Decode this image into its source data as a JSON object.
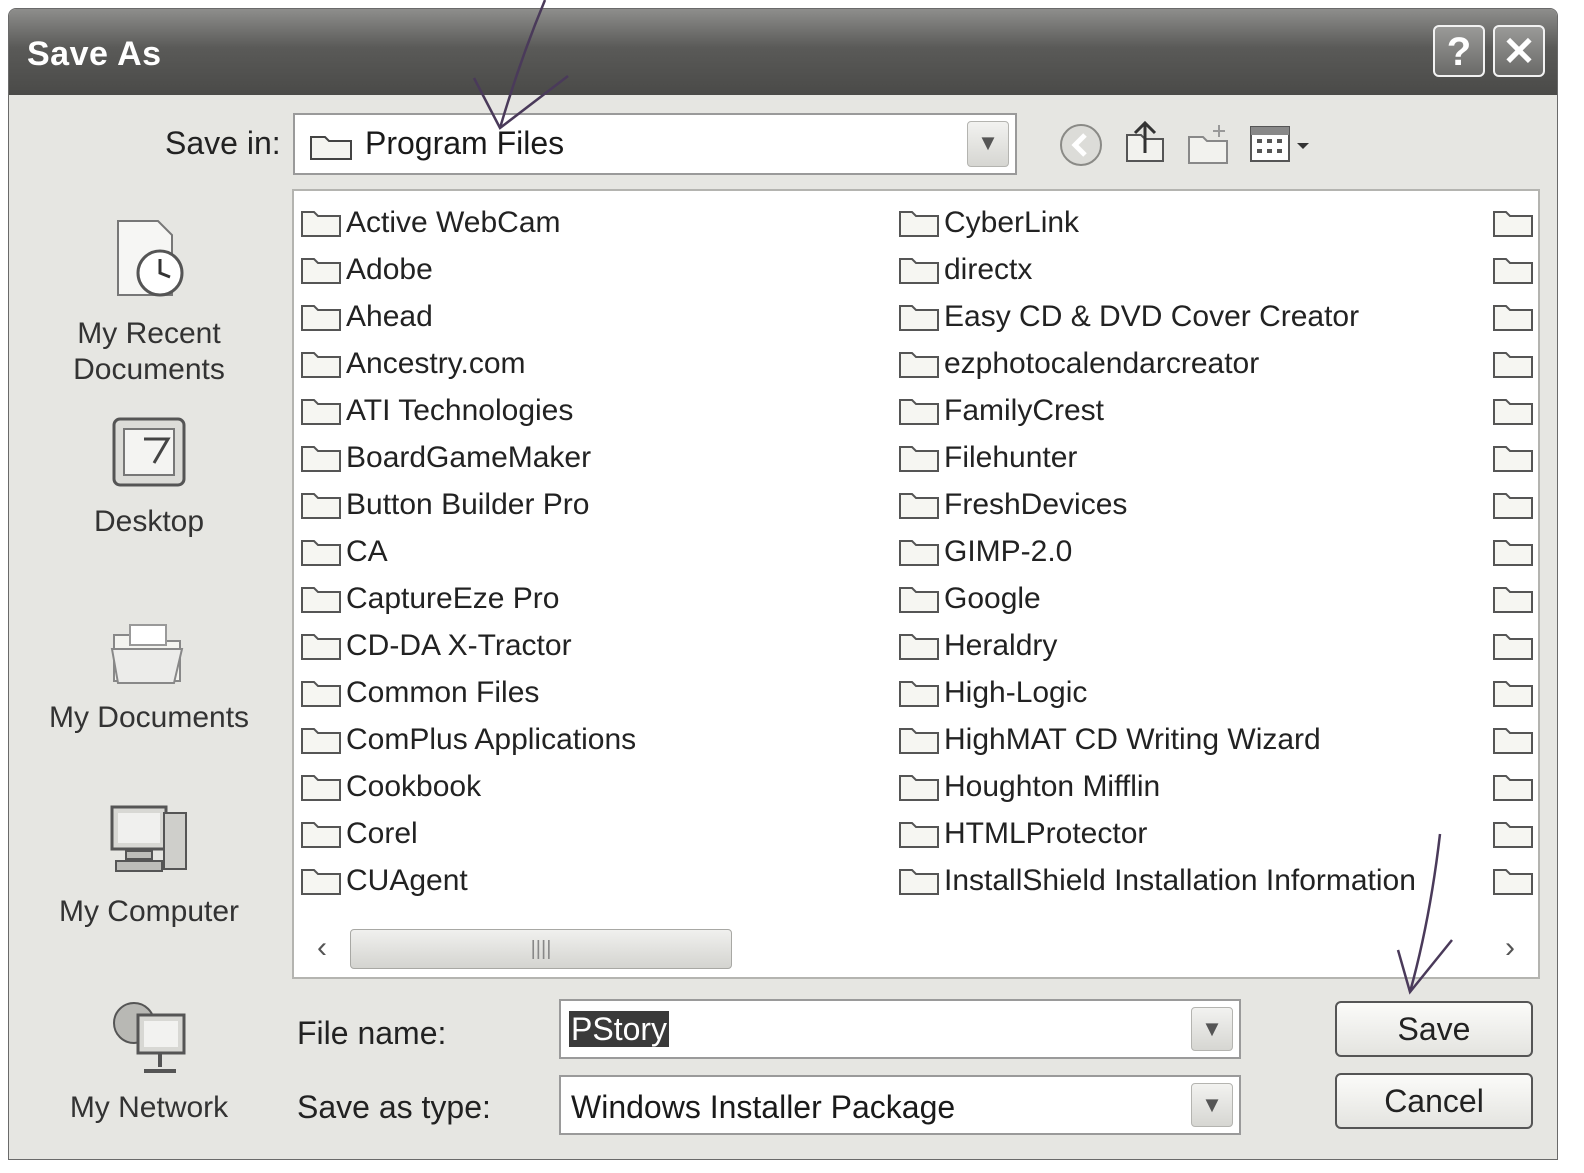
{
  "window": {
    "title": "Save As",
    "help_glyph": "?",
    "close_glyph": "✕"
  },
  "toolbar": {
    "save_in_label": "Save in:",
    "save_in_value": "Program Files",
    "icons": [
      "back-icon",
      "up-folder-icon",
      "new-folder-icon",
      "views-menu-icon"
    ]
  },
  "places": [
    {
      "label": "My Recent Documents"
    },
    {
      "label": "Desktop"
    },
    {
      "label": "My Documents"
    },
    {
      "label": "My Computer"
    },
    {
      "label": "My Network"
    }
  ],
  "files": {
    "col1": [
      "Active WebCam",
      "Adobe",
      "Ahead",
      "Ancestry.com",
      "ATI Technologies",
      "BoardGameMaker",
      "Button Builder Pro",
      "CA",
      "CaptureEze Pro",
      "CD-DA X-Tractor",
      "Common Files",
      "ComPlus Applications",
      "Cookbook",
      "Corel",
      "CUAgent"
    ],
    "col2": [
      "CyberLink",
      "directx",
      "Easy CD & DVD Cover Creator",
      "ezphotocalendarcreator",
      "FamilyCrest",
      "Filehunter",
      "FreshDevices",
      "GIMP-2.0",
      "Google",
      "Heraldry",
      "High-Logic",
      "HighMAT CD Writing Wizard",
      "Houghton Mifflin",
      "HTMLProtector",
      "InstallShield Installation Information"
    ]
  },
  "form": {
    "file_name_label": "File name:",
    "file_name_value": "PStory",
    "save_as_type_label": "Save as type:",
    "save_as_type_value": "Windows Installer Package"
  },
  "buttons": {
    "save": "Save",
    "cancel": "Cancel"
  },
  "scrollbar": {
    "grip": "||||"
  },
  "colors": {
    "title_bar": "#5a5a58",
    "dialog_bg": "#e6e6e2",
    "selection": "#3a3a3a"
  }
}
